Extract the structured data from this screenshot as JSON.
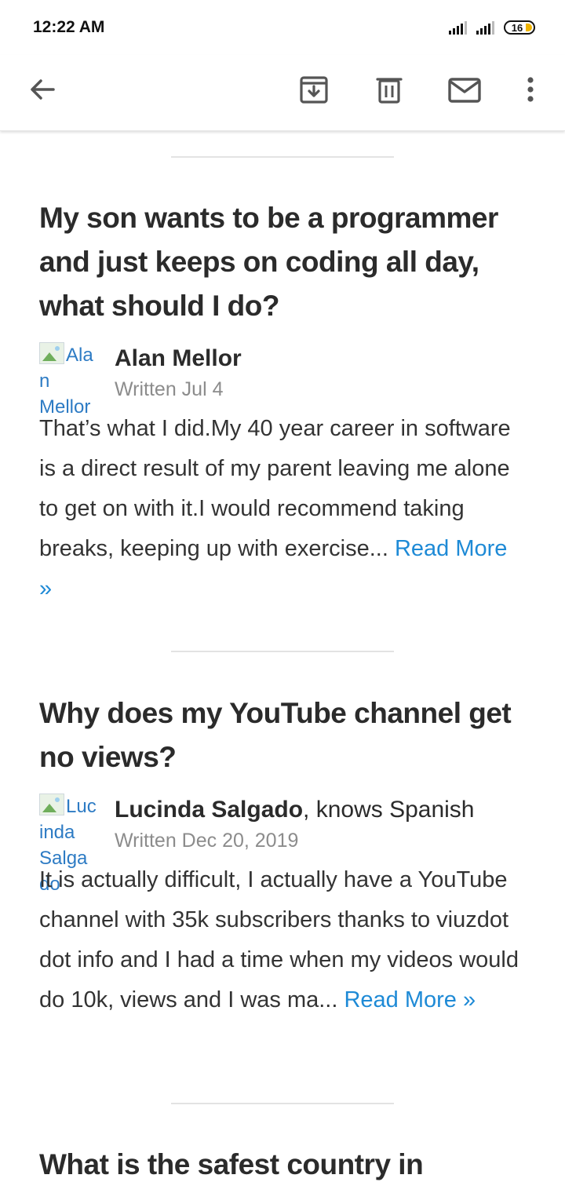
{
  "status_bar": {
    "time": "12:22 AM",
    "battery": "16"
  },
  "toolbar": {
    "icons": [
      "back-arrow-icon",
      "archive-icon",
      "trash-icon",
      "mail-icon",
      "more-vert-icon"
    ]
  },
  "colors": {
    "link": "#1e8ad6",
    "title": "#2b2b2b",
    "meta": "#8c8c8c",
    "avatar_alt": "#2d7bc4"
  },
  "posts": [
    {
      "question": "My son wants to be a programmer and just keeps on coding all day, what should I do?",
      "avatar_alt_lines": [
        "Ala",
        "n",
        "Mellor"
      ],
      "author": "Alan Mellor",
      "credential": "",
      "date": "Written Jul 4",
      "excerpt": "That’s what I did.My 40 year career in software is a direct result of my parent leaving me alone to get on with it.I would recommend taking breaks, keeping up with exercise...",
      "read_more": "Read More »"
    },
    {
      "question": "Why does my YouTube channel get no views?",
      "avatar_alt_lines": [
        "Luc",
        "inda",
        "Salga",
        "do"
      ],
      "author": "Lucinda Salgado",
      "credential": ", knows Spanish",
      "date": "Written Dec 20, 2019",
      "excerpt": "It is actually difficult, I actually have a YouTube channel with 35k subscribers thanks to viuzdot dot info and I had a time when my videos would do 10k, views and I was ma...",
      "read_more": "Read More »"
    },
    {
      "question": "What is the safest country in"
    }
  ]
}
